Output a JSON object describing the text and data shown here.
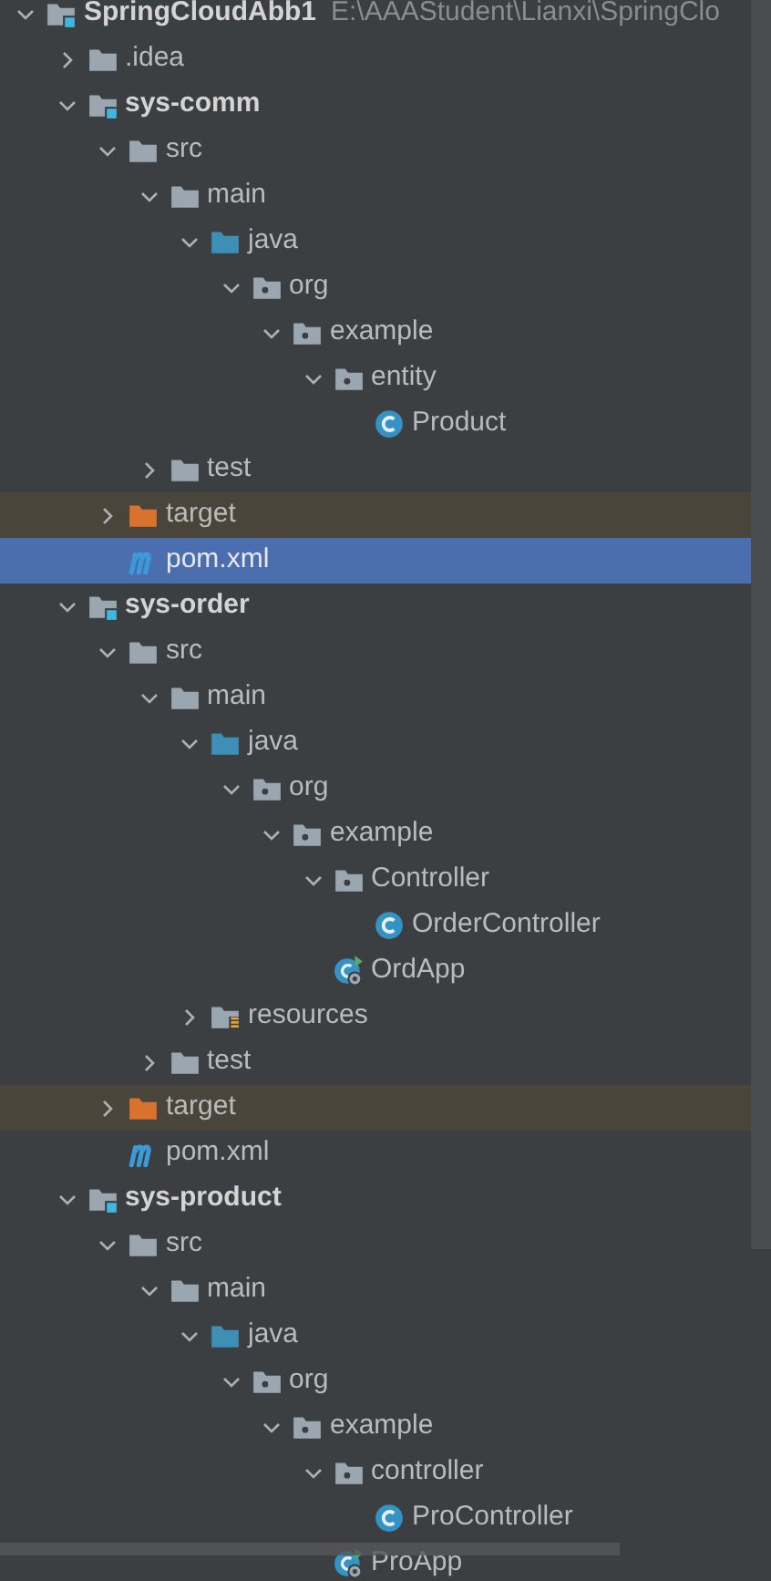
{
  "tree": [
    {
      "label": "SpringCloudAbb1",
      "path": "E:\\AAAStudent\\Lianxi\\SpringClo",
      "kind": "module",
      "expanded": true,
      "selected": false,
      "children": [
        {
          "label": ".idea",
          "kind": "folder",
          "expanded": false,
          "selected": false
        },
        {
          "label": "sys-comm",
          "kind": "module",
          "expanded": true,
          "selected": false,
          "children": [
            {
              "label": "src",
              "kind": "folder",
              "expanded": true,
              "selected": false,
              "children": [
                {
                  "label": "main",
                  "kind": "folder",
                  "expanded": true,
                  "selected": false,
                  "children": [
                    {
                      "label": "java",
                      "kind": "source-folder",
                      "expanded": true,
                      "selected": false,
                      "children": [
                        {
                          "label": "org",
                          "kind": "package",
                          "expanded": true,
                          "selected": false,
                          "children": [
                            {
                              "label": "example",
                              "kind": "package",
                              "expanded": true,
                              "selected": false,
                              "children": [
                                {
                                  "label": "entity",
                                  "kind": "package",
                                  "expanded": true,
                                  "selected": false,
                                  "children": [
                                    {
                                      "label": "Product",
                                      "kind": "class",
                                      "selected": false
                                    }
                                  ]
                                }
                              ]
                            }
                          ]
                        }
                      ]
                    }
                  ]
                },
                {
                  "label": "test",
                  "kind": "folder",
                  "expanded": false,
                  "selected": false
                }
              ]
            },
            {
              "label": "target",
              "kind": "excluded-folder",
              "expanded": false,
              "selected": false
            },
            {
              "label": "pom.xml",
              "kind": "maven",
              "selected": true
            }
          ]
        },
        {
          "label": "sys-order",
          "kind": "module",
          "expanded": true,
          "selected": false,
          "children": [
            {
              "label": "src",
              "kind": "folder",
              "expanded": true,
              "selected": false,
              "children": [
                {
                  "label": "main",
                  "kind": "folder",
                  "expanded": true,
                  "selected": false,
                  "children": [
                    {
                      "label": "java",
                      "kind": "source-folder",
                      "expanded": true,
                      "selected": false,
                      "children": [
                        {
                          "label": "org",
                          "kind": "package",
                          "expanded": true,
                          "selected": false,
                          "children": [
                            {
                              "label": "example",
                              "kind": "package",
                              "expanded": true,
                              "selected": false,
                              "children": [
                                {
                                  "label": "Controller",
                                  "kind": "package",
                                  "expanded": true,
                                  "selected": false,
                                  "children": [
                                    {
                                      "label": "OrderController",
                                      "kind": "class",
                                      "selected": false
                                    }
                                  ]
                                },
                                {
                                  "label": "OrdApp",
                                  "kind": "app-class",
                                  "selected": false
                                }
                              ]
                            }
                          ]
                        }
                      ]
                    },
                    {
                      "label": "resources",
                      "kind": "resources-folder",
                      "expanded": false,
                      "selected": false
                    }
                  ]
                },
                {
                  "label": "test",
                  "kind": "folder",
                  "expanded": false,
                  "selected": false
                }
              ]
            },
            {
              "label": "target",
              "kind": "excluded-folder",
              "expanded": false,
              "selected": false
            },
            {
              "label": "pom.xml",
              "kind": "maven",
              "selected": false
            }
          ]
        },
        {
          "label": "sys-product",
          "kind": "module",
          "expanded": true,
          "selected": false,
          "children": [
            {
              "label": "src",
              "kind": "folder",
              "expanded": true,
              "selected": false,
              "children": [
                {
                  "label": "main",
                  "kind": "folder",
                  "expanded": true,
                  "selected": false,
                  "children": [
                    {
                      "label": "java",
                      "kind": "source-folder",
                      "expanded": true,
                      "selected": false,
                      "children": [
                        {
                          "label": "org",
                          "kind": "package",
                          "expanded": true,
                          "selected": false,
                          "children": [
                            {
                              "label": "example",
                              "kind": "package",
                              "expanded": true,
                              "selected": false,
                              "children": [
                                {
                                  "label": "controller",
                                  "kind": "package",
                                  "expanded": true,
                                  "selected": false,
                                  "children": [
                                    {
                                      "label": "ProController",
                                      "kind": "class",
                                      "selected": false
                                    }
                                  ]
                                },
                                {
                                  "label": "ProApp",
                                  "kind": "app-class",
                                  "selected": false
                                }
                              ]
                            }
                          ]
                        }
                      ]
                    }
                  ]
                }
              ]
            }
          ]
        }
      ]
    }
  ]
}
